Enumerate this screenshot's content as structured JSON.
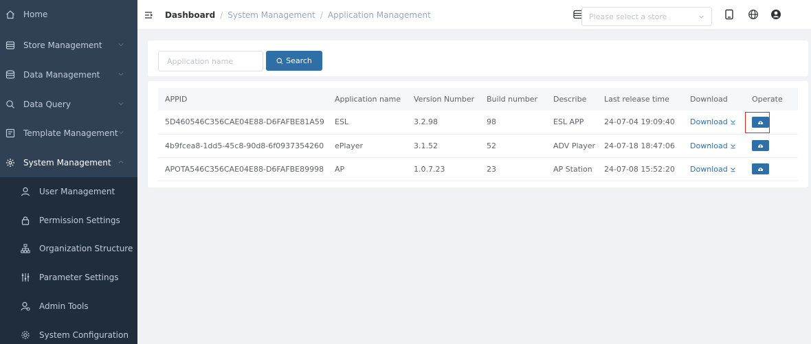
{
  "sidebar": {
    "items": [
      {
        "label": "Home",
        "icon": "home-icon"
      },
      {
        "label": "Store Management",
        "icon": "store-icon"
      },
      {
        "label": "Data Management",
        "icon": "database-icon"
      },
      {
        "label": "Data Query",
        "icon": "search-icon"
      },
      {
        "label": "Template Management",
        "icon": "template-icon"
      },
      {
        "label": "System Management",
        "icon": "gear-icon"
      }
    ],
    "sub_items": [
      {
        "label": "User Management",
        "icon": "user-icon"
      },
      {
        "label": "Permission Settings",
        "icon": "lock-icon"
      },
      {
        "label": "Organization Structure",
        "icon": "org-structure-icon"
      },
      {
        "label": "Parameter Settings",
        "icon": "parameter-icon"
      },
      {
        "label": "Admin Tools",
        "icon": "admin-icon"
      },
      {
        "label": "System Configuration",
        "icon": "config-icon"
      }
    ]
  },
  "header": {
    "breadcrumb": [
      "Dashboard",
      "System Management",
      "Application Management"
    ],
    "store_placeholder": "Please select a store"
  },
  "search": {
    "placeholder": "Application name",
    "button_label": "Search"
  },
  "table": {
    "columns": [
      "APPID",
      "Application name",
      "Version Number",
      "Build number",
      "Describe",
      "Last release time",
      "Download",
      "Operate"
    ],
    "rows": [
      {
        "appid": "5D460546C356CAE04E88-D6FAFBE81A59",
        "name": "ESL",
        "version": "3.2.98",
        "build": "98",
        "describe": "ESL APP",
        "last_release": "24-07-04 19:09:40",
        "download": "Download"
      },
      {
        "appid": "4b9fcea8-1dd5-45c8-90d8-6f0937354260",
        "name": "ePlayer",
        "version": "3.1.52",
        "build": "52",
        "describe": "ADV Player",
        "last_release": "24-07-18 18:47:06",
        "download": "Download"
      },
      {
        "appid": "APOTA546C356CAE04E88-D6FAFBE89998",
        "name": "AP",
        "version": "1.0.7.23",
        "build": "23",
        "describe": "AP Station",
        "last_release": "24-07-08 15:52:20",
        "download": "Download"
      }
    ]
  },
  "colors": {
    "sidebar_bg": "#304156",
    "submenu_bg": "#1f2d3d",
    "primary": "#2f6fa8",
    "highlight": "#e0241a"
  }
}
